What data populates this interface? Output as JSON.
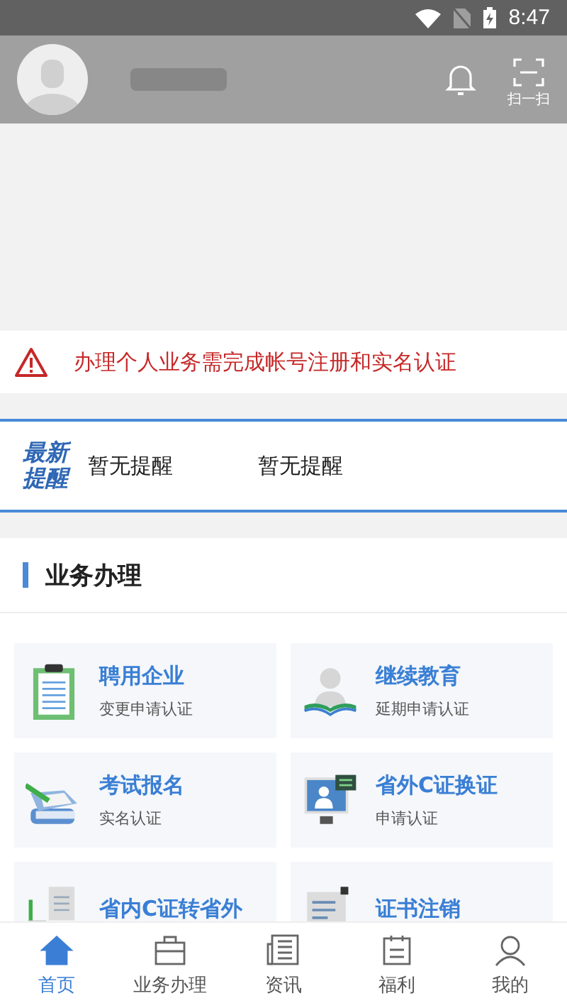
{
  "status_bar": {
    "time": "8:47"
  },
  "header": {
    "scan_label": "扫一扫"
  },
  "notice": {
    "text": "办理个人业务需完成帐号注册和实名认证"
  },
  "news": {
    "badge_line1": "最新",
    "badge_line2": "提醒",
    "items": [
      "暂无提醒",
      "暂无提醒"
    ]
  },
  "section": {
    "title": "业务办理"
  },
  "services": [
    {
      "kind": "clipboard",
      "title": "聘用企业",
      "subtitle": "变更申请认证"
    },
    {
      "kind": "reader",
      "title": "继续教育",
      "subtitle": "延期申请认证"
    },
    {
      "kind": "book",
      "title": "考试报名",
      "subtitle": "实名认证"
    },
    {
      "kind": "monitor",
      "title": "省外C证换证",
      "subtitle": "申请认证"
    },
    {
      "kind": "documents",
      "title": "省内C证转省外"
    },
    {
      "kind": "certificate",
      "title": "证书注销"
    }
  ],
  "tabs": [
    {
      "kind": "home",
      "label": "首页",
      "selected": true
    },
    {
      "kind": "briefcase",
      "label": "业务办理",
      "selected": false
    },
    {
      "kind": "news",
      "label": "资讯",
      "selected": false
    },
    {
      "kind": "calendar",
      "label": "福利",
      "selected": false
    },
    {
      "kind": "person",
      "label": "我的",
      "selected": false
    }
  ]
}
